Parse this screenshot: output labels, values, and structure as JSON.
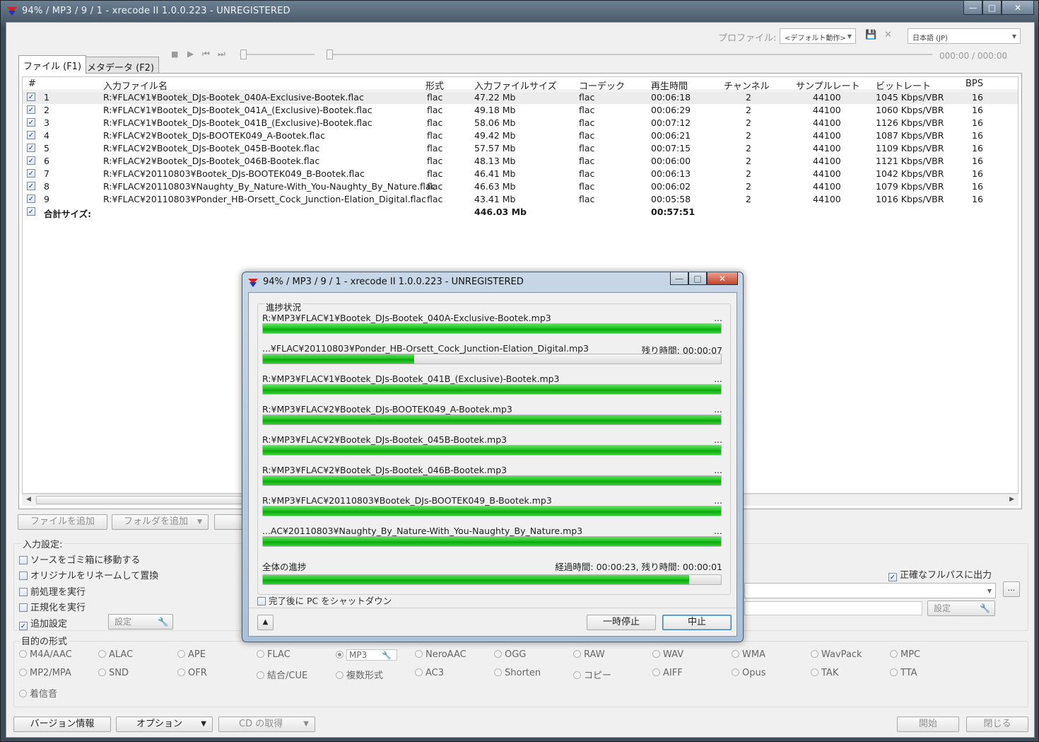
{
  "main_window": {
    "title": "94% / MP3 / 9 / 1 - xrecode II 1.0.0.223 - UNREGISTERED",
    "profile_label": "プロファイル:",
    "profile_value": "<デフォルト動作>",
    "language_value": "日本語 (JP)",
    "time_display": "000:00 / 000:00",
    "tabs": [
      {
        "label": "ファイル (F1)"
      },
      {
        "label": "メタデータ (F2)"
      }
    ]
  },
  "file_table": {
    "columns": [
      "#",
      "入力ファイル名",
      "形式",
      "入力ファイルサイズ",
      "コーデック",
      "再生時間",
      "チャンネル",
      "サンプルレート",
      "ビットレート",
      "BPS"
    ],
    "rows": [
      {
        "n": "1",
        "name": "R:¥FLAC¥1¥Bootek_DJs-Bootek_040A-Exclusive-Bootek.flac",
        "fmt": "flac",
        "size": "47.22 Mb",
        "codec": "flac",
        "time": "00:06:18",
        "ch": "2",
        "sr": "44100",
        "br": "1045 Kbps/VBR",
        "bps": "16"
      },
      {
        "n": "2",
        "name": "R:¥FLAC¥1¥Bootek_DJs-Bootek_041A_(Exclusive)-Bootek.flac",
        "fmt": "flac",
        "size": "49.18 Mb",
        "codec": "flac",
        "time": "00:06:29",
        "ch": "2",
        "sr": "44100",
        "br": "1060 Kbps/VBR",
        "bps": "16"
      },
      {
        "n": "3",
        "name": "R:¥FLAC¥1¥Bootek_DJs-Bootek_041B_(Exclusive)-Bootek.flac",
        "fmt": "flac",
        "size": "58.06 Mb",
        "codec": "flac",
        "time": "00:07:12",
        "ch": "2",
        "sr": "44100",
        "br": "1126 Kbps/VBR",
        "bps": "16"
      },
      {
        "n": "4",
        "name": "R:¥FLAC¥2¥Bootek_DJs-BOOTEK049_A-Bootek.flac",
        "fmt": "flac",
        "size": "49.42 Mb",
        "codec": "flac",
        "time": "00:06:21",
        "ch": "2",
        "sr": "44100",
        "br": "1087 Kbps/VBR",
        "bps": "16"
      },
      {
        "n": "5",
        "name": "R:¥FLAC¥2¥Bootek_DJs-Bootek_045B-Bootek.flac",
        "fmt": "flac",
        "size": "57.57 Mb",
        "codec": "flac",
        "time": "00:07:15",
        "ch": "2",
        "sr": "44100",
        "br": "1109 Kbps/VBR",
        "bps": "16"
      },
      {
        "n": "6",
        "name": "R:¥FLAC¥2¥Bootek_DJs-Bootek_046B-Bootek.flac",
        "fmt": "flac",
        "size": "48.13 Mb",
        "codec": "flac",
        "time": "00:06:00",
        "ch": "2",
        "sr": "44100",
        "br": "1121 Kbps/VBR",
        "bps": "16"
      },
      {
        "n": "7",
        "name": "R:¥FLAC¥20110803¥Bootek_DJs-BOOTEK049_B-Bootek.flac",
        "fmt": "flac",
        "size": "46.41 Mb",
        "codec": "flac",
        "time": "00:06:13",
        "ch": "2",
        "sr": "44100",
        "br": "1042 Kbps/VBR",
        "bps": "16"
      },
      {
        "n": "8",
        "name": "R:¥FLAC¥20110803¥Naughty_By_Nature-With_You-Naughty_By_Nature.flac",
        "fmt": "flac",
        "size": "46.63 Mb",
        "codec": "flac",
        "time": "00:06:02",
        "ch": "2",
        "sr": "44100",
        "br": "1079 Kbps/VBR",
        "bps": "16"
      },
      {
        "n": "9",
        "name": "R:¥FLAC¥20110803¥Ponder_HB-Orsett_Cock_Junction-Elation_Digital.flac",
        "fmt": "flac",
        "size": "43.41 Mb",
        "codec": "flac",
        "time": "00:05:58",
        "ch": "2",
        "sr": "44100",
        "br": "1016 Kbps/VBR",
        "bps": "16"
      }
    ],
    "total_label": "合計サイズ:",
    "total_size": "446.03 Mb",
    "total_time": "00:57:51"
  },
  "list_buttons": {
    "add_file": "ファイルを追加",
    "add_folder": "フォルダを追加"
  },
  "input_settings": {
    "label": "入力設定:",
    "options": [
      "ソースをゴミ箱に移動する",
      "オリジナルをリネームして置換",
      "前処理を実行",
      "正規化を実行",
      "追加設定"
    ],
    "settings_button": "設定",
    "fullpath_label": "正確なフルパスに出力",
    "settings_button_right": "設定",
    "browse": "..."
  },
  "target_format": {
    "label": "目的の形式",
    "row1": [
      "M4A/AAC",
      "ALAC",
      "APE",
      "FLAC",
      "MP3",
      "NeroAAC",
      "OGG",
      "RAW",
      "WAV",
      "WMA",
      "WavPack",
      "MPC"
    ],
    "row2": [
      "MP2/MPA",
      "SND",
      "OFR",
      "結合/CUE",
      "複数形式",
      "AC3",
      "Shorten",
      "コピー",
      "AIFF",
      "Opus",
      "TAK",
      "TTA"
    ],
    "row3": [
      "着信音"
    ],
    "selected": "MP3"
  },
  "bottom_buttons": {
    "version": "バージョン情報",
    "options": "オプション",
    "cd": "CD の取得",
    "start": "開始",
    "close": "閉じる"
  },
  "dialog": {
    "title": "94% / MP3 / 9 / 1 - xrecode II 1.0.0.223 - UNREGISTERED",
    "group_label": "進捗状況",
    "items": [
      {
        "name": "R:¥MP3¥FLAC¥1¥Bootek_DJs-Bootek_040A-Exclusive-Bootek.mp3",
        "right": "...",
        "progress": 1.0
      },
      {
        "name": "...¥FLAC¥20110803¥Ponder_HB-Orsett_Cock_Junction-Elation_Digital.mp3",
        "right": "残り時間: 00:00:07",
        "progress": 0.33
      },
      {
        "name": "R:¥MP3¥FLAC¥1¥Bootek_DJs-Bootek_041B_(Exclusive)-Bootek.mp3",
        "right": "...",
        "progress": 1.0
      },
      {
        "name": "R:¥MP3¥FLAC¥2¥Bootek_DJs-BOOTEK049_A-Bootek.mp3",
        "right": "...",
        "progress": 1.0
      },
      {
        "name": "R:¥MP3¥FLAC¥2¥Bootek_DJs-Bootek_045B-Bootek.mp3",
        "right": "...",
        "progress": 1.0
      },
      {
        "name": "R:¥MP3¥FLAC¥2¥Bootek_DJs-Bootek_046B-Bootek.mp3",
        "right": "...",
        "progress": 1.0
      },
      {
        "name": "R:¥MP3¥FLAC¥20110803¥Bootek_DJs-BOOTEK049_B-Bootek.mp3",
        "right": "...",
        "progress": 1.0
      },
      {
        "name": "...AC¥20110803¥Naughty_By_Nature-With_You-Naughty_By_Nature.mp3",
        "right": "...",
        "progress": 1.0
      }
    ],
    "overall_label": "全体の進捗",
    "overall_right": "経過時間: 00:00:23, 残り時間: 00:00:01",
    "overall_progress": 0.93,
    "shutdown_label": "完了後に PC をシャットダウン",
    "pause_button": "一時停止",
    "abort_button": "中止"
  }
}
